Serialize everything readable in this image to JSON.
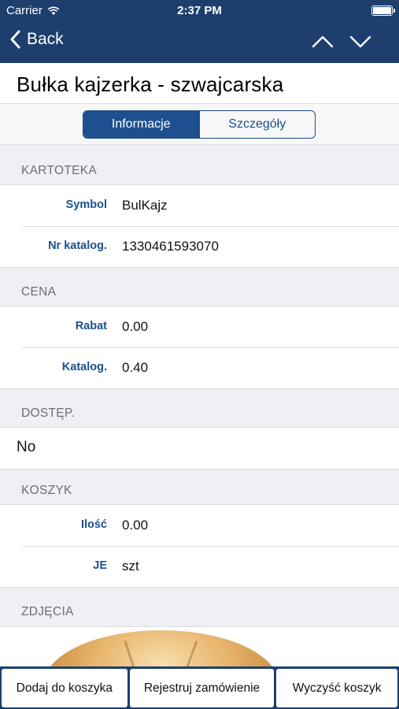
{
  "status_bar": {
    "carrier": "Carrier",
    "time": "2:37 PM"
  },
  "nav": {
    "back_label": "Back"
  },
  "product": {
    "title": "Bułka kajzerka - szwajcarska"
  },
  "tabs": [
    {
      "label": "Informacje",
      "active": true
    },
    {
      "label": "Szczegóły",
      "active": false
    }
  ],
  "sections": {
    "kartoteka": {
      "header": "KARTOTEKA",
      "rows": [
        {
          "label": "Symbol",
          "value": "BulKajz"
        },
        {
          "label": "Nr katalog.",
          "value": "1330461593070"
        }
      ]
    },
    "cena": {
      "header": "CENA",
      "rows": [
        {
          "label": "Rabat",
          "value": "0.00"
        },
        {
          "label": "Katalog.",
          "value": "0.40"
        }
      ]
    },
    "dostep": {
      "header": "DOSTĘP.",
      "value": "No"
    },
    "koszyk": {
      "header": "KOSZYK",
      "rows": [
        {
          "label": "Ilość",
          "value": "0.00"
        },
        {
          "label": "JE",
          "value": "szt"
        }
      ]
    },
    "zdjecia": {
      "header": "ZDJĘCIA"
    }
  },
  "actions": [
    {
      "label": "Dodaj do koszyka"
    },
    {
      "label": "Rejestruj zamówienie"
    },
    {
      "label": "Wyczyść koszyk"
    }
  ],
  "colors": {
    "nav_bar": "#1e3f6e",
    "accent": "#1e4f8e",
    "background": "#efeff4"
  },
  "icons": [
    "wifi-icon",
    "battery-icon",
    "back-chevron-icon",
    "chevron-up-icon",
    "chevron-down-icon"
  ]
}
